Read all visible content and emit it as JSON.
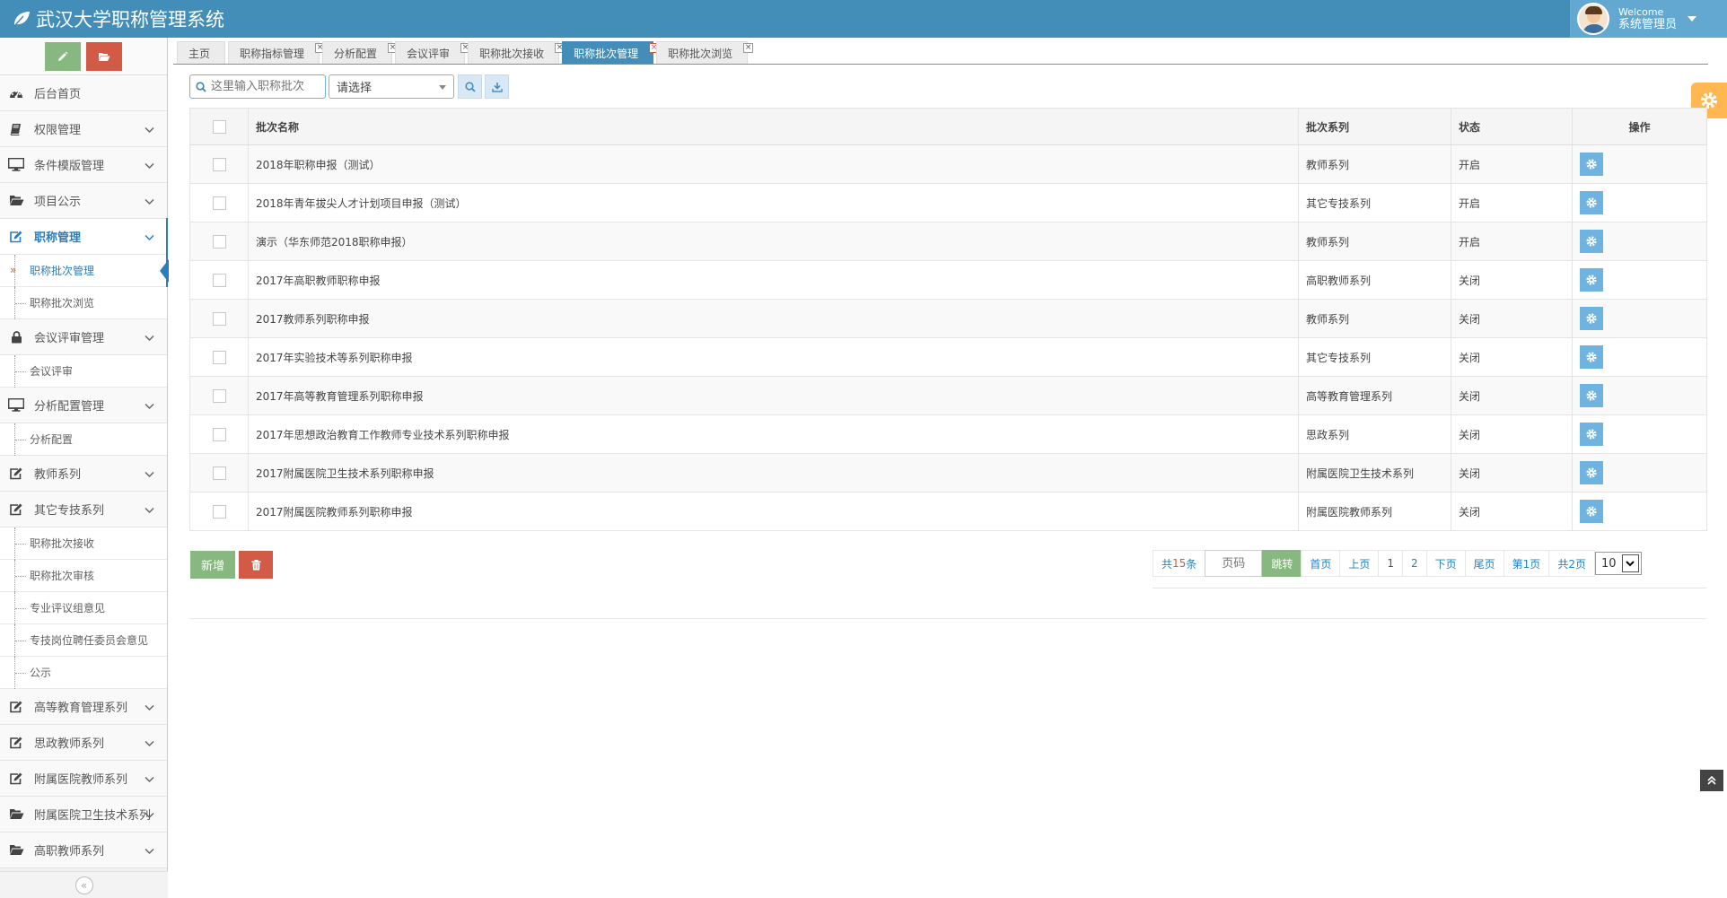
{
  "app": {
    "title": "武汉大学职称管理系统"
  },
  "user": {
    "welcome": "Welcome",
    "name": "系统管理员"
  },
  "sidebar": {
    "items": [
      {
        "label": "后台首页",
        "icon": "dashboard-icon"
      },
      {
        "label": "权限管理",
        "icon": "book-icon"
      },
      {
        "label": "条件模版管理",
        "icon": "desktop-icon"
      },
      {
        "label": "项目公示",
        "icon": "folder-open-icon"
      },
      {
        "label": "职称管理",
        "icon": "edit-icon",
        "children": [
          "职称批次管理",
          "职称批次浏览"
        ]
      },
      {
        "label": "会议评审管理",
        "icon": "lock-icon",
        "children": [
          "会议评审"
        ]
      },
      {
        "label": "分析配置管理",
        "icon": "desktop-icon",
        "children": [
          "分析配置"
        ]
      },
      {
        "label": "教师系列",
        "icon": "edit-icon"
      },
      {
        "label": "其它专技系列",
        "icon": "edit-icon",
        "children": [
          "职称批次接收",
          "职称批次审核",
          "专业评议组意见",
          "专技岗位聘任委员会意见",
          "公示"
        ]
      },
      {
        "label": "高等教育管理系列",
        "icon": "edit-icon"
      },
      {
        "label": "思政教师系列",
        "icon": "edit-icon"
      },
      {
        "label": "附属医院教师系列",
        "icon": "edit-icon"
      },
      {
        "label": "附属医院卫生技术系列",
        "icon": "folder-open-icon"
      },
      {
        "label": "高职教师系列",
        "icon": "folder-open-icon"
      }
    ],
    "collapse_glyph": "«"
  },
  "tabs": [
    "主页",
    "职称指标管理",
    "分析配置",
    "会议评审",
    "职称批次接收",
    "职称批次管理",
    "职称批次浏览"
  ],
  "toolbar": {
    "search_placeholder": "这里输入职称批次",
    "select_value": "请选择"
  },
  "table": {
    "headers": [
      "批次名称",
      "批次系列",
      "状态",
      "操作"
    ],
    "rows": [
      {
        "name": "2018年职称申报（测试）",
        "series": "教师系列",
        "status": "开启"
      },
      {
        "name": "2018年青年拔尖人才计划项目申报（测试）",
        "series": "其它专技系列",
        "status": "开启"
      },
      {
        "name": "演示（华东师范2018职称申报）",
        "series": "教师系列",
        "status": "开启"
      },
      {
        "name": "2017年高职教师职称申报",
        "series": "高职教师系列",
        "status": "关闭"
      },
      {
        "name": "2017教师系列职称申报",
        "series": "教师系列",
        "status": "关闭"
      },
      {
        "name": "2017年实验技术等系列职称申报",
        "series": "其它专技系列",
        "status": "关闭"
      },
      {
        "name": "2017年高等教育管理系列职称申报",
        "series": "高等教育管理系列",
        "status": "关闭"
      },
      {
        "name": "2017年思想政治教育工作教师专业技术系列职称申报",
        "series": "思政系列",
        "status": "关闭"
      },
      {
        "name": "2017附属医院卫生技术系列职称申报",
        "series": "附属医院卫生技术系列",
        "status": "关闭"
      },
      {
        "name": "2017附属医院教师系列职称申报",
        "series": "附属医院教师系列",
        "status": "关闭"
      }
    ]
  },
  "buttons": {
    "add": "新增"
  },
  "pager": {
    "total_prefix": "共",
    "total_count": "15",
    "total_suffix": "条",
    "page_input_placeholder": "页码",
    "jump": "跳转",
    "first": "首页",
    "prev": "上页",
    "pages": [
      "1",
      "2"
    ],
    "next": "下页",
    "last": "尾页",
    "current": "第1页",
    "total_pages": "共2页",
    "page_size": "10"
  },
  "colors": {
    "navbar": "#438eb9",
    "accent": "#2b7dbc",
    "success": "#87b87f",
    "danger": "#d15b47",
    "info": "#6fb3e0",
    "warning": "#ffb752"
  }
}
